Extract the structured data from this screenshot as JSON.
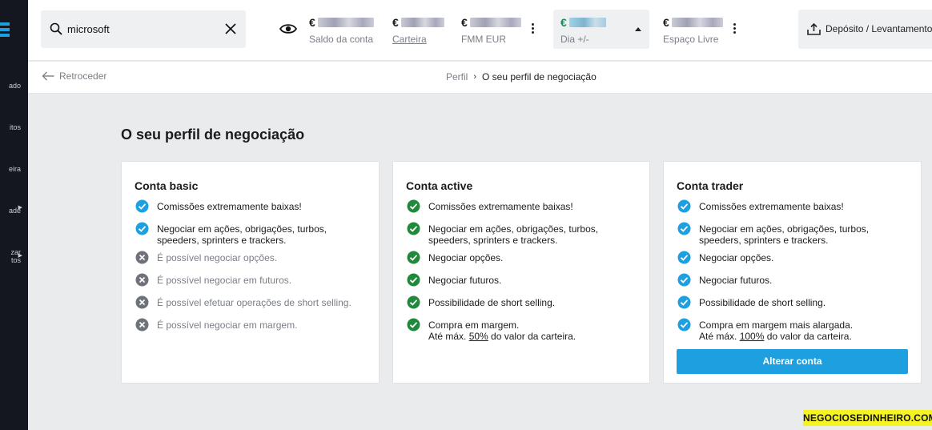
{
  "sidebar": {
    "items": [
      {
        "label": "ado",
        "icon": "markets-icon"
      },
      {
        "label": "itos",
        "icon": "favorites-icon"
      },
      {
        "label": "eira",
        "icon": "portfolio-icon"
      },
      {
        "label": "ade",
        "icon": "activity-icon"
      },
      {
        "label": "zar",
        "icon": "menu-icon"
      },
      {
        "label": "tos",
        "icon": ""
      }
    ]
  },
  "search": {
    "value": "microsoft"
  },
  "stats": [
    {
      "currency": "€",
      "label": "Saldo da conta"
    },
    {
      "currency": "€",
      "label": "Carteira"
    },
    {
      "currency": "€",
      "label": "FMM EUR"
    },
    {
      "currency": "€",
      "label": "Dia +/-"
    },
    {
      "currency": "€",
      "label": "Espaço Livre"
    }
  ],
  "deposit": {
    "label": "Depósito / Levantamento"
  },
  "breadcrumb": {
    "back": "Retroceder",
    "parent": "Perfil",
    "current": "O seu perfil de negociação"
  },
  "page": {
    "title": "O seu perfil de negociação"
  },
  "cards": [
    {
      "title": "Conta basic",
      "features": [
        {
          "text": "Comissões extremamente baixas!",
          "enabled": true
        },
        {
          "text": "Negociar em ações, obrigações, turbos,",
          "text2": "speeders, sprinters e trackers.",
          "enabled": true
        },
        {
          "text": "É possível negociar opções.",
          "enabled": false
        },
        {
          "text": "É possível negociar em futuros.",
          "enabled": false
        },
        {
          "text": "É possível efetuar operações de short selling.",
          "enabled": false
        },
        {
          "text": "É possível negociar em margem.",
          "enabled": false
        }
      ]
    },
    {
      "title": "Conta active",
      "features": [
        {
          "text": "Comissões extremamente baixas!",
          "enabled": true
        },
        {
          "text": "Negociar em ações, obrigações, turbos,",
          "text2": "speeders, sprinters e trackers.",
          "enabled": true
        },
        {
          "text": "Negociar opções.",
          "enabled": true
        },
        {
          "text": "Negociar futuros.",
          "enabled": true
        },
        {
          "text": "Possibilidade de short selling.",
          "enabled": true
        },
        {
          "text": "Compra em margem.",
          "text2a": "Até máx. ",
          "pct": "50%",
          "text2b": " do valor da carteira.",
          "enabled": true
        }
      ]
    },
    {
      "title": "Conta trader",
      "features": [
        {
          "text": "Comissões extremamente baixas!",
          "enabled": true
        },
        {
          "text": "Negociar em ações, obrigações, turbos,",
          "text2": "speeders, sprinters e trackers.",
          "enabled": true
        },
        {
          "text": "Negociar opções.",
          "enabled": true
        },
        {
          "text": "Negociar futuros.",
          "enabled": true
        },
        {
          "text": "Possibilidade de short selling.",
          "enabled": true
        },
        {
          "text": "Compra em margem mais alargada.",
          "text2a": "Até máx. ",
          "pct": "100%",
          "text2b": " do valor da carteira.",
          "enabled": true
        }
      ],
      "button": "Alterar conta"
    }
  ],
  "colors": {
    "check_blue": "#1ea0e0",
    "check_green": "#1f8a3b",
    "cross_grey": "#6f7379",
    "accent": "#1ea0e0",
    "positive": "#1f8a5a"
  },
  "watermark": "NEGOCIOSEDINHEIRO.COM"
}
